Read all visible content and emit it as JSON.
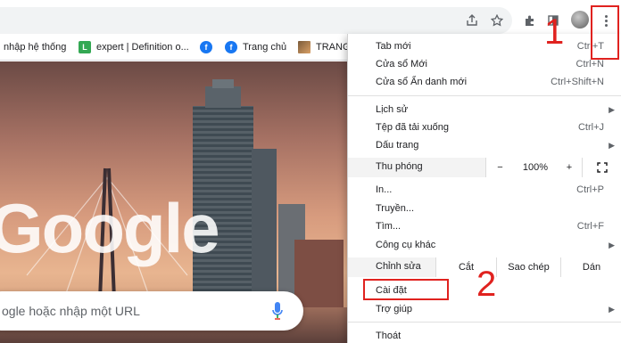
{
  "toolbar": {
    "icons": [
      "share-icon",
      "star-icon",
      "extensions-icon",
      "reading-list-icon",
      "avatar",
      "more-menu-icon"
    ]
  },
  "bookmarks": [
    {
      "label": "nhập hệ thống",
      "icon": "none"
    },
    {
      "label": "expert | Definition o...",
      "icon": "green-l-favicon"
    },
    {
      "label": "",
      "icon": "facebook-favicon"
    },
    {
      "label": "Trang chủ",
      "icon": "facebook-favicon"
    },
    {
      "label": "TRANG",
      "icon": "image-favicon"
    }
  ],
  "ntp": {
    "logo": "Google",
    "search_placeholder": "ogle hoặc nhập một URL"
  },
  "menu": {
    "new_tab": {
      "label": "Tab mới",
      "shortcut": "Ctrl+T"
    },
    "new_window": {
      "label": "Cửa sổ Mới",
      "shortcut": "Ctrl+N"
    },
    "incognito": {
      "label": "Cửa sổ Ẩn danh mới",
      "shortcut": "Ctrl+Shift+N"
    },
    "history": {
      "label": "Lịch sử"
    },
    "downloads": {
      "label": "Tệp đã tải xuống",
      "shortcut": "Ctrl+J"
    },
    "bookmarks": {
      "label": "Dấu trang"
    },
    "zoom": {
      "label": "Thu phóng",
      "minus": "−",
      "value": "100%",
      "plus": "+"
    },
    "print": {
      "label": "In...",
      "shortcut": "Ctrl+P"
    },
    "cast": {
      "label": "Truyền..."
    },
    "find": {
      "label": "Tìm...",
      "shortcut": "Ctrl+F"
    },
    "more_tools": {
      "label": "Công cụ khác"
    },
    "edit": {
      "label": "Chỉnh sửa",
      "cut": "Cắt",
      "copy": "Sao chép",
      "paste": "Dán"
    },
    "settings": {
      "label": "Cài đặt"
    },
    "help": {
      "label": "Trợ giúp"
    },
    "exit": {
      "label": "Thoát"
    }
  },
  "annotations": {
    "step1": "1",
    "step2": "2",
    "color": "#e0221f"
  }
}
